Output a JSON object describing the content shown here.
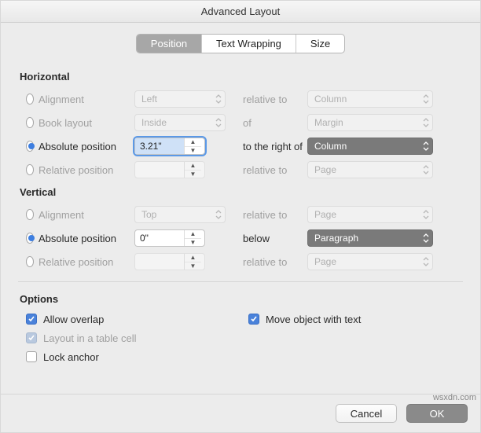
{
  "title": "Advanced Layout",
  "tabs": {
    "position": "Position",
    "wrap": "Text Wrapping",
    "size": "Size"
  },
  "horiz": {
    "heading": "Horizontal",
    "alignment": {
      "label": "Alignment",
      "val": "Left",
      "rel": "relative to",
      "relval": "Column"
    },
    "book": {
      "label": "Book layout",
      "val": "Inside",
      "rel": "of",
      "relval": "Margin"
    },
    "abs": {
      "label": "Absolute position",
      "val": "3.21\"",
      "rel": "to the right of",
      "relval": "Column"
    },
    "relpos": {
      "label": "Relative position",
      "val": "",
      "rel": "relative to",
      "relval": "Page"
    }
  },
  "vert": {
    "heading": "Vertical",
    "alignment": {
      "label": "Alignment",
      "val": "Top",
      "rel": "relative to",
      "relval": "Page"
    },
    "abs": {
      "label": "Absolute position",
      "val": "0\"",
      "rel": "below",
      "relval": "Paragraph"
    },
    "relpos": {
      "label": "Relative position",
      "val": "",
      "rel": "relative to",
      "relval": "Page"
    }
  },
  "options": {
    "heading": "Options",
    "allow_overlap": "Allow overlap",
    "layout_cell": "Layout in a table cell",
    "lock_anchor": "Lock anchor",
    "move_text": "Move object with text"
  },
  "buttons": {
    "cancel": "Cancel",
    "ok": "OK"
  },
  "watermark": "wsxdn.com"
}
